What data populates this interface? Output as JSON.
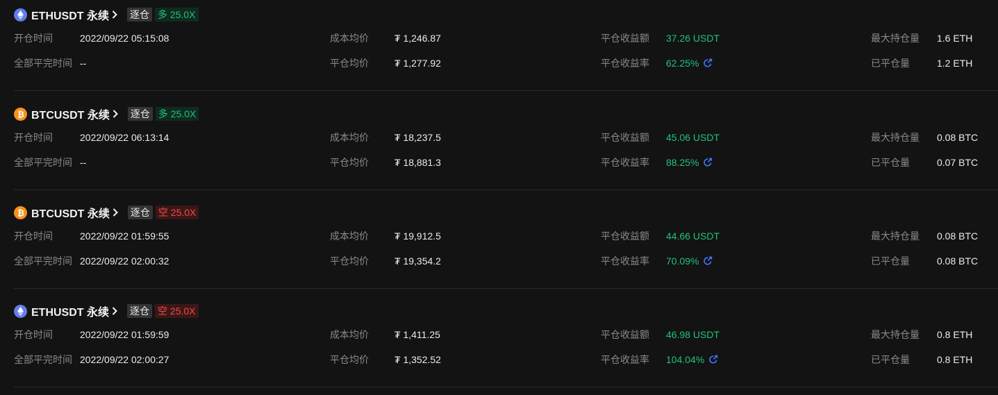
{
  "labels": {
    "open_time": "开仓时间",
    "close_time": "全部平完时间",
    "avg_cost": "成本均价",
    "avg_close": "平仓均价",
    "pnl_amount": "平仓收益额",
    "pnl_rate": "平仓收益率",
    "max_position": "最大持仓量",
    "closed_qty": "已平仓量"
  },
  "colors": {
    "background": "#131313",
    "positive": "#22c27c",
    "long_tag": "#25c07c",
    "short_tag": "#f0484a",
    "eth": "#627eea",
    "btc": "#f7931a",
    "share": "#3d7bff"
  },
  "positions": [
    {
      "coin_icon": "ethereum-icon",
      "symbol": "ETHUSDT 永续",
      "margin_mode": "逐仓",
      "side_leverage": "多 25.0X",
      "side": "long",
      "open_time": "2022/09/22 05:15:08",
      "close_time": "--",
      "avg_cost": "₮ 1,246.87",
      "avg_close": "₮ 1,277.92",
      "pnl_amount": "37.26 USDT",
      "pnl_rate": "62.25%",
      "max_position": "1.6 ETH",
      "closed_qty": "1.2 ETH"
    },
    {
      "coin_icon": "bitcoin-icon",
      "symbol": "BTCUSDT 永续",
      "margin_mode": "逐仓",
      "side_leverage": "多 25.0X",
      "side": "long",
      "open_time": "2022/09/22 06:13:14",
      "close_time": "--",
      "avg_cost": "₮ 18,237.5",
      "avg_close": "₮ 18,881.3",
      "pnl_amount": "45.06 USDT",
      "pnl_rate": "88.25%",
      "max_position": "0.08 BTC",
      "closed_qty": "0.07 BTC"
    },
    {
      "coin_icon": "bitcoin-icon",
      "symbol": "BTCUSDT 永续",
      "margin_mode": "逐仓",
      "side_leverage": "空 25.0X",
      "side": "short",
      "open_time": "2022/09/22 01:59:55",
      "close_time": "2022/09/22 02:00:32",
      "avg_cost": "₮ 19,912.5",
      "avg_close": "₮ 19,354.2",
      "pnl_amount": "44.66 USDT",
      "pnl_rate": "70.09%",
      "max_position": "0.08 BTC",
      "closed_qty": "0.08 BTC"
    },
    {
      "coin_icon": "ethereum-icon",
      "symbol": "ETHUSDT 永续",
      "margin_mode": "逐仓",
      "side_leverage": "空 25.0X",
      "side": "short",
      "open_time": "2022/09/22 01:59:59",
      "close_time": "2022/09/22 02:00:27",
      "avg_cost": "₮ 1,411.25",
      "avg_close": "₮ 1,352.52",
      "pnl_amount": "46.98 USDT",
      "pnl_rate": "104.04%",
      "max_position": "0.8 ETH",
      "closed_qty": "0.8 ETH"
    }
  ]
}
